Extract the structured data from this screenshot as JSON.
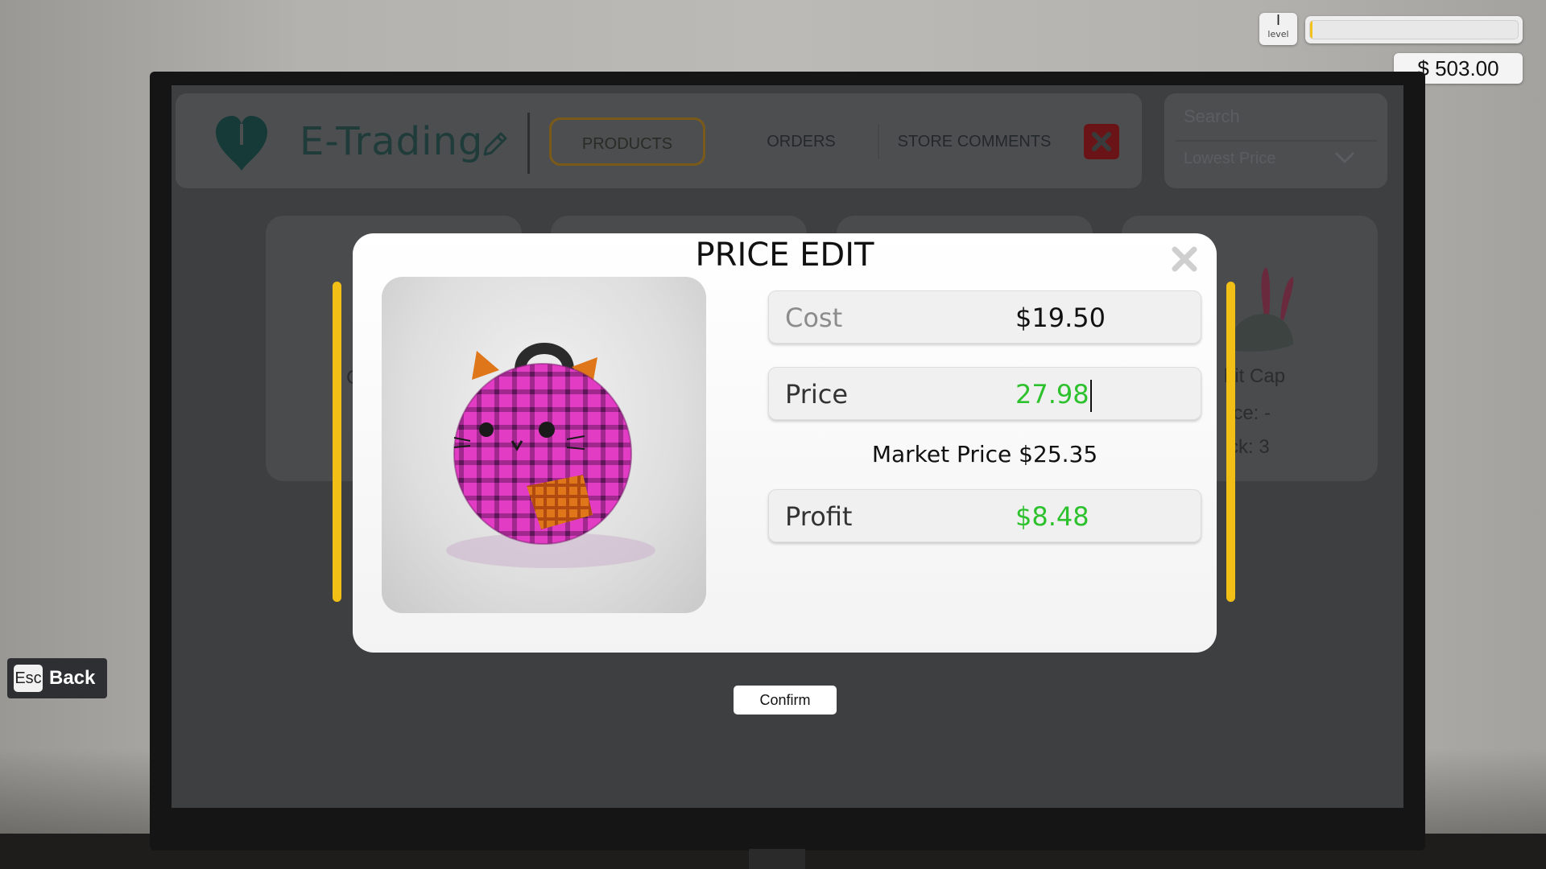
{
  "hud": {
    "level": "I",
    "level_label": "level",
    "xp_fraction": 0.01,
    "money": "$ 503.00"
  },
  "app": {
    "name": "E-Trading",
    "tabs": [
      "PRODUCTS",
      "ORDERS",
      "STORE COMMENTS"
    ],
    "active_tab": "PRODUCTS",
    "search_placeholder": "Search",
    "sort_selected": "Lowest Price"
  },
  "background_cards": {
    "card4_name_partial": "bit Cap",
    "card4_price_partial": "ice: -",
    "card4_stock_partial": "ck: 3",
    "card1_partial": "C"
  },
  "modal": {
    "title": "PRICE EDIT",
    "product_icon": "pink-plaid-cat-bag",
    "cost_label": "Cost",
    "cost_value": "$19.50",
    "price_label": "Price",
    "price_value": "27.98",
    "market_price_text": "Market Price $25.35",
    "profit_label": "Profit",
    "profit_value": "$8.48",
    "confirm_label": "Confirm"
  },
  "controls": {
    "esc_key": "Esc",
    "back_label": "Back"
  },
  "colors": {
    "accent_yellow": "#f1bf16",
    "profit_green": "#2ec12e",
    "close_red": "#6b1417"
  }
}
